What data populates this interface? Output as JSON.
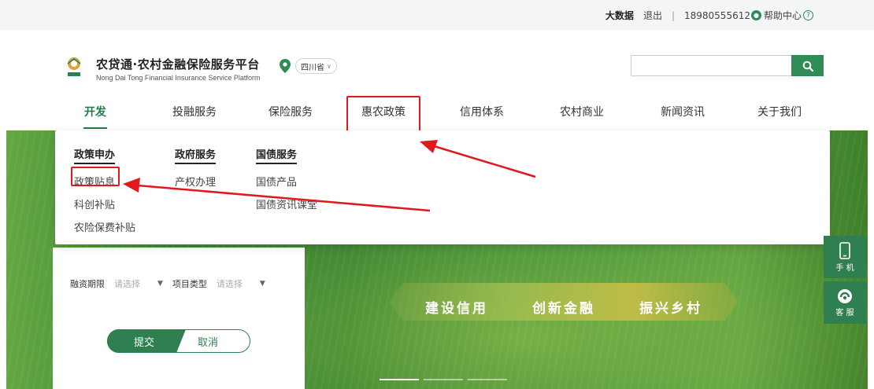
{
  "topbar": {
    "big_data": "大数据",
    "logout": "退出",
    "separator": "|",
    "phone": "18980555612",
    "help": "帮助中心"
  },
  "header": {
    "brand_cn": "农贷通·农村金融保险服务平台",
    "brand_en": "Nong Dai Tong Financial Insurance Service Platform",
    "logo_caption": "农贷通",
    "province": "四川省",
    "search_value": "",
    "search_placeholder": ""
  },
  "nav": {
    "items": [
      {
        "label": "开发"
      },
      {
        "label": "投融服务"
      },
      {
        "label": "保险服务"
      },
      {
        "label": "惠农政策"
      },
      {
        "label": "信用体系"
      },
      {
        "label": "农村商业"
      },
      {
        "label": "新闻资讯"
      },
      {
        "label": "关于我们"
      }
    ],
    "active_index": 0
  },
  "mega_menu": {
    "columns": [
      {
        "title": "政策申办",
        "links": [
          "政策贴息",
          "科创补贴",
          "农险保费补贴"
        ]
      },
      {
        "title": "政府服务",
        "links": [
          "产权办理"
        ]
      },
      {
        "title": "国债服务",
        "links": [
          "国债产品",
          "国债资讯课堂"
        ]
      }
    ]
  },
  "form": {
    "term_label": "融资期限",
    "term_value": "请选择",
    "type_label": "项目类型",
    "type_value": "请选择",
    "submit": "提交",
    "cancel": "取消"
  },
  "hero": {
    "slogans": [
      "建设信用",
      "创新金融",
      "振兴乡村"
    ]
  },
  "side_tools": {
    "phone": "手 机",
    "service": "客 服"
  },
  "colors": {
    "brand_green": "#2f7f51",
    "active_nav": "#1f7a45",
    "annotation_red": "#e0191c"
  }
}
